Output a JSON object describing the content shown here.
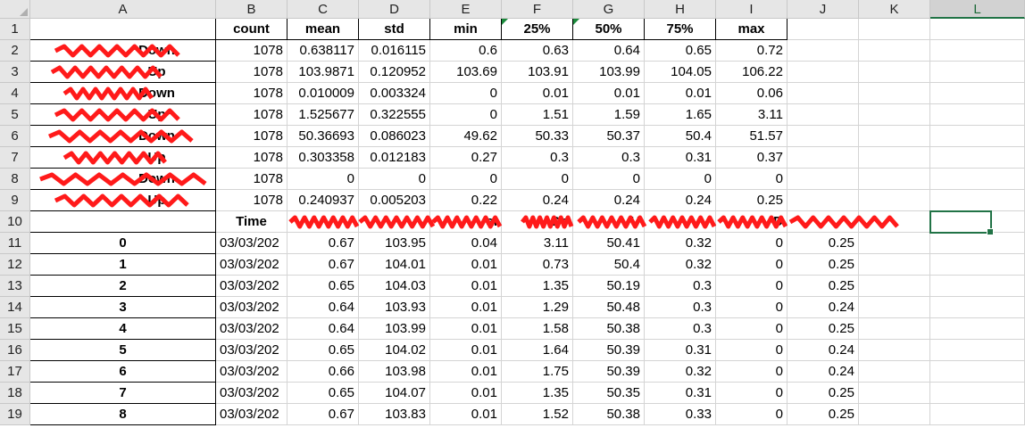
{
  "column_headers": [
    "A",
    "B",
    "C",
    "D",
    "E",
    "F",
    "G",
    "H",
    "I",
    "J",
    "K",
    "L"
  ],
  "selected_column": "L",
  "row_headers": [
    "1",
    "2",
    "3",
    "4",
    "5",
    "6",
    "7",
    "8",
    "9",
    "10",
    "11",
    "12",
    "13",
    "14",
    "15",
    "16",
    "17",
    "18",
    "19"
  ],
  "describe_table": {
    "stat_headers": [
      "count",
      "mean",
      "std",
      "min",
      "25%",
      "50%",
      "75%",
      "max"
    ],
    "row_labels": [
      "Down",
      "Up",
      "Down",
      "Up",
      "Down",
      "Up",
      "Down",
      "Up"
    ],
    "rows": [
      [
        "1078",
        "0.638117",
        "0.016115",
        "0.6",
        "0.63",
        "0.64",
        "0.65",
        "0.72"
      ],
      [
        "1078",
        "103.9871",
        "0.120952",
        "103.69",
        "103.91",
        "103.99",
        "104.05",
        "106.22"
      ],
      [
        "1078",
        "0.010009",
        "0.003324",
        "0",
        "0.01",
        "0.01",
        "0.01",
        "0.06"
      ],
      [
        "1078",
        "1.525677",
        "0.322555",
        "0",
        "1.51",
        "1.59",
        "1.65",
        "3.11"
      ],
      [
        "1078",
        "50.36693",
        "0.086023",
        "49.62",
        "50.33",
        "50.37",
        "50.4",
        "51.57"
      ],
      [
        "1078",
        "0.303358",
        "0.012183",
        "0.27",
        "0.3",
        "0.3",
        "0.31",
        "0.37"
      ],
      [
        "1078",
        "0",
        "0",
        "0",
        "0",
        "0",
        "0",
        "0"
      ],
      [
        "1078",
        "0.240937",
        "0.005203",
        "0.22",
        "0.24",
        "0.24",
        "0.24",
        "0.25"
      ]
    ]
  },
  "data_table": {
    "header_time": "Time",
    "header_fragments": [
      "",
      "",
      "al",
      "Do",
      "U",
      "",
      "D",
      "",
      ""
    ],
    "rows": [
      [
        "0",
        "03/03/202",
        "0.67",
        "103.95",
        "0.04",
        "3.11",
        "50.41",
        "0.32",
        "0",
        "0.25"
      ],
      [
        "1",
        "03/03/202",
        "0.67",
        "104.01",
        "0.01",
        "0.73",
        "50.4",
        "0.32",
        "0",
        "0.25"
      ],
      [
        "2",
        "03/03/202",
        "0.65",
        "104.03",
        "0.01",
        "1.35",
        "50.19",
        "0.3",
        "0",
        "0.25"
      ],
      [
        "3",
        "03/03/202",
        "0.64",
        "103.93",
        "0.01",
        "1.29",
        "50.48",
        "0.3",
        "0",
        "0.24"
      ],
      [
        "4",
        "03/03/202",
        "0.64",
        "103.99",
        "0.01",
        "1.58",
        "50.38",
        "0.3",
        "0",
        "0.25"
      ],
      [
        "5",
        "03/03/202",
        "0.65",
        "104.02",
        "0.01",
        "1.64",
        "50.39",
        "0.31",
        "0",
        "0.24"
      ],
      [
        "6",
        "03/03/202",
        "0.66",
        "103.98",
        "0.01",
        "1.75",
        "50.39",
        "0.32",
        "0",
        "0.24"
      ],
      [
        "7",
        "03/03/202",
        "0.65",
        "104.07",
        "0.01",
        "1.35",
        "50.35",
        "0.31",
        "0",
        "0.25"
      ],
      [
        "8",
        "03/03/202",
        "0.67",
        "103.83",
        "0.01",
        "1.52",
        "50.38",
        "0.33",
        "0",
        "0.25"
      ]
    ]
  },
  "colors": {
    "selection_accent": "#217346",
    "redaction": "#ff1a1a",
    "error_indicator": "#1b8a3c"
  }
}
